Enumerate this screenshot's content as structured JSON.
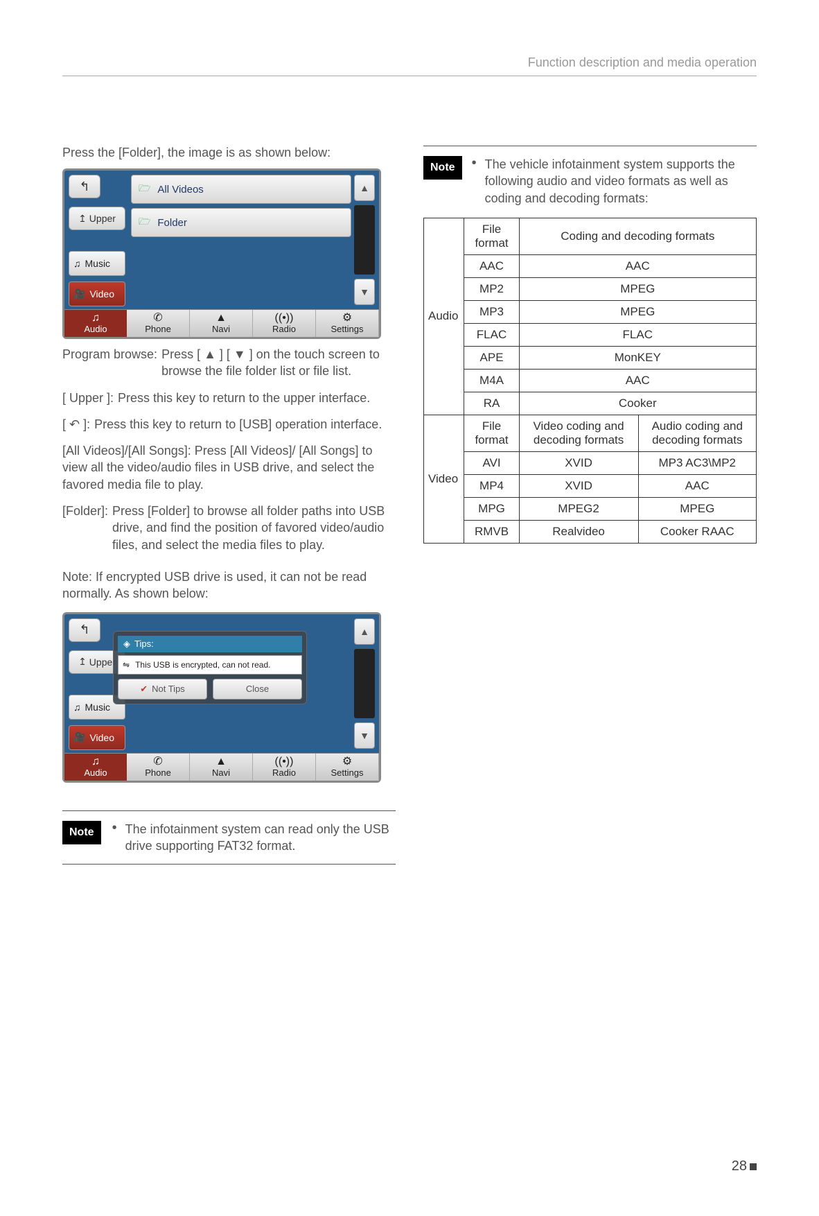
{
  "header": "Function description and media operation",
  "page_number": "28",
  "left": {
    "intro": "Press the [Folder], the image is as shown below:",
    "shot1": {
      "back_icon": "↰",
      "upper_btn": "Upper",
      "side_music": "Music",
      "side_video": "Video",
      "row_all_videos": "All Videos",
      "row_folder": "Folder",
      "nav": [
        "Audio",
        "Phone",
        "Navi",
        "Radio",
        "Settings"
      ],
      "nav_icons": [
        "♫",
        "✆",
        "▲",
        "((•))",
        "⚙"
      ]
    },
    "program_browse_label": "Program browse:",
    "program_browse_text": "Press [ ▲ ] [ ▼ ] on the touch screen to browse the file folder list or file list.",
    "upper_label": "[ Upper ]:",
    "upper_text": "Press this key to return to the upper interface.",
    "back_label_prefix": "[ ",
    "back_label_icon": "↶",
    "back_label_suffix": " ]:",
    "back_text": "Press this key to return to [USB] operation interface.",
    "allvideos_label": "[All Videos]/[All Songs]:",
    "allvideos_text": "Press  [All Videos]/ [All Songs] to view all the video/audio files in USB drive, and select the favored media file to play.",
    "folder_label": "[Folder]:",
    "folder_text": "Press [Folder] to browse all folder paths into USB drive, and find the position of favored video/audio files, and select the media files to play.",
    "note_encrypted": "Note: If encrypted USB drive is used, it can not be read normally. As shown below:",
    "shot2": {
      "tips_title": "Tips:",
      "tips_body": "This USB is encrypted, can not read.",
      "btn_not_tips": "Not Tips",
      "btn_close": "Close"
    },
    "note_fat32": "The infotainment system can read only the USB drive supporting FAT32 format."
  },
  "right": {
    "note_intro": "The vehicle infotainment system supports the following audio and video formats as well as coding and decoding formats:",
    "note_badge": "Note",
    "audio_label": "Audio",
    "video_label": "Video",
    "audio_header_ff": "File format",
    "audio_header_cd": "Coding and decoding formats",
    "audio_rows": [
      {
        "ff": "AAC",
        "cd": "AAC"
      },
      {
        "ff": "MP2",
        "cd": "MPEG"
      },
      {
        "ff": "MP3",
        "cd": "MPEG"
      },
      {
        "ff": "FLAC",
        "cd": "FLAC"
      },
      {
        "ff": "APE",
        "cd": "MonKEY"
      },
      {
        "ff": "M4A",
        "cd": "AAC"
      },
      {
        "ff": "RA",
        "cd": "Cooker"
      }
    ],
    "video_header_ff": "File format",
    "video_header_v": "Video coding and decoding formats",
    "video_header_a": "Audio coding and decoding formats",
    "video_rows": [
      {
        "ff": "AVI",
        "v": "XVID",
        "a": "MP3 AC3\\MP2"
      },
      {
        "ff": "MP4",
        "v": "XVID",
        "a": "AAC"
      },
      {
        "ff": "MPG",
        "v": "MPEG2",
        "a": "MPEG"
      },
      {
        "ff": "RMVB",
        "v": "Realvideo",
        "a": "Cooker RAAC"
      }
    ]
  }
}
